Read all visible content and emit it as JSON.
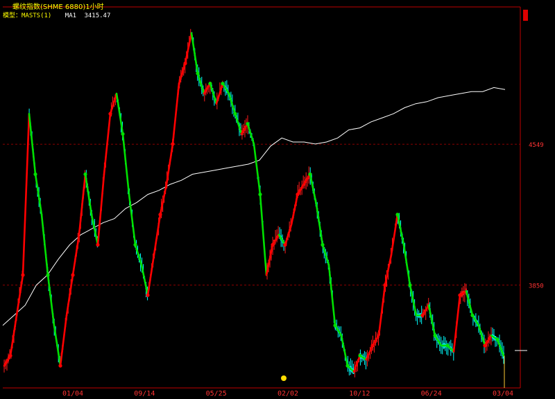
{
  "title": "螺纹指数(SHME 6880)1小时",
  "legend": {
    "model": "模型：MASTS(1)",
    "ma_name": "MA1",
    "ma_value": "3415.47"
  },
  "colors": {
    "background": "#000000",
    "frame": "#c00000",
    "grid": "#a00000",
    "up": "#ff1a1a",
    "down": "#00ffff",
    "trend_up": "#ff0000",
    "trend_down": "#00e000",
    "ma_line": "#ffffff",
    "axis_text": "#ff3333",
    "title": "#ffff00",
    "marker": "#ffdd00"
  },
  "chart_data": {
    "type": "line",
    "title": "螺纹指数(SHME 6880)1小时",
    "xlabel": "",
    "ylabel": "",
    "x_tick_labels": [
      "01/04",
      "09/14",
      "05/25",
      "02/02",
      "10/12",
      "06/24",
      "03/04"
    ],
    "y_tick_labels": [
      4549,
      3850
    ],
    "ylim": [
      3340,
      5230
    ],
    "grid": "horizontal dashed at labeled levels",
    "series": [
      {
        "role": "price",
        "values": [
          3450,
          3500,
          3700,
          3900,
          4700,
          4400,
          4200,
          3900,
          3650,
          3450,
          3700,
          3900,
          4100,
          4400,
          4200,
          4050,
          4400,
          4700,
          4800,
          4600,
          4300,
          4050,
          3950,
          3800,
          4000,
          4200,
          4350,
          4550,
          4850,
          4950,
          5100,
          4900,
          4800,
          4850,
          4750,
          4850,
          4800,
          4700,
          4600,
          4650,
          4550,
          4300,
          3900,
          4050,
          4100,
          4050,
          4150,
          4300,
          4350,
          4400,
          4250,
          4050,
          3950,
          3650,
          3600,
          3450,
          3420,
          3500,
          3480,
          3550,
          3600,
          3850,
          4000,
          4200,
          4050,
          3850,
          3700,
          3700,
          3750,
          3600,
          3550,
          3550,
          3520,
          3800,
          3820,
          3700,
          3650,
          3550,
          3600,
          3580,
          3500
        ]
      },
      {
        "role": "moving average",
        "values": [
          3650,
          3700,
          3750,
          3850,
          3900,
          3980,
          4050,
          4100,
          4130,
          4160,
          4180,
          4230,
          4260,
          4300,
          4320,
          4350,
          4370,
          4400,
          4410,
          4420,
          4430,
          4440,
          4450,
          4470,
          4540,
          4580,
          4560,
          4560,
          4550,
          4560,
          4580,
          4620,
          4630,
          4660,
          4680,
          4700,
          4730,
          4750,
          4760,
          4780,
          4790,
          4800,
          4810,
          4810,
          4830,
          4820
        ]
      }
    ]
  }
}
